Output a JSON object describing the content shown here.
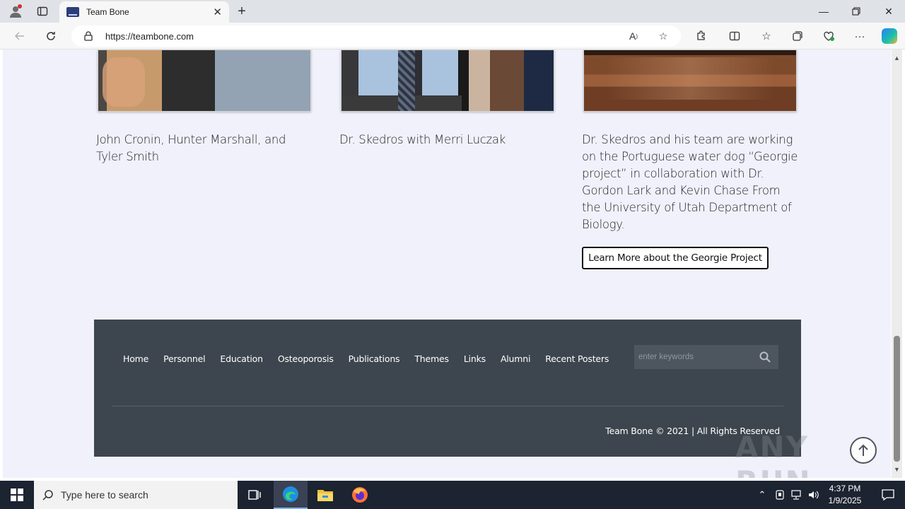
{
  "browser": {
    "tab_title": "Team Bone",
    "url": "https://teambone.com"
  },
  "page": {
    "captions": [
      "John Cronin, Hunter Marshall, and Tyler Smith",
      "Dr. Skedros with Merri Luczak",
      "Dr. Skedros and his team are working on the Portuguese water dog “Georgie project” in collaboration with Dr. Gordon Lark and Kevin Chase From the University of Utah Department of Biology."
    ],
    "learn_more_label": "Learn More about the Georgie Project"
  },
  "footer": {
    "nav": [
      "Home",
      "Personnel",
      "Education",
      "Osteoporosis",
      "Publications",
      "Themes",
      "Links",
      "Alumni",
      "Recent Posters"
    ],
    "search_placeholder": "enter keywords",
    "copyright": "Team Bone © 2021 | All Rights Reserved"
  },
  "watermark": "ANY RUN",
  "taskbar": {
    "search_placeholder": "Type here to search",
    "time": "4:37 PM",
    "date": "1/9/2025"
  },
  "colors": {
    "page_bg": "#f0f1fb",
    "footer_bg": "#3d464e",
    "taskbar_bg": "#1c2331"
  }
}
